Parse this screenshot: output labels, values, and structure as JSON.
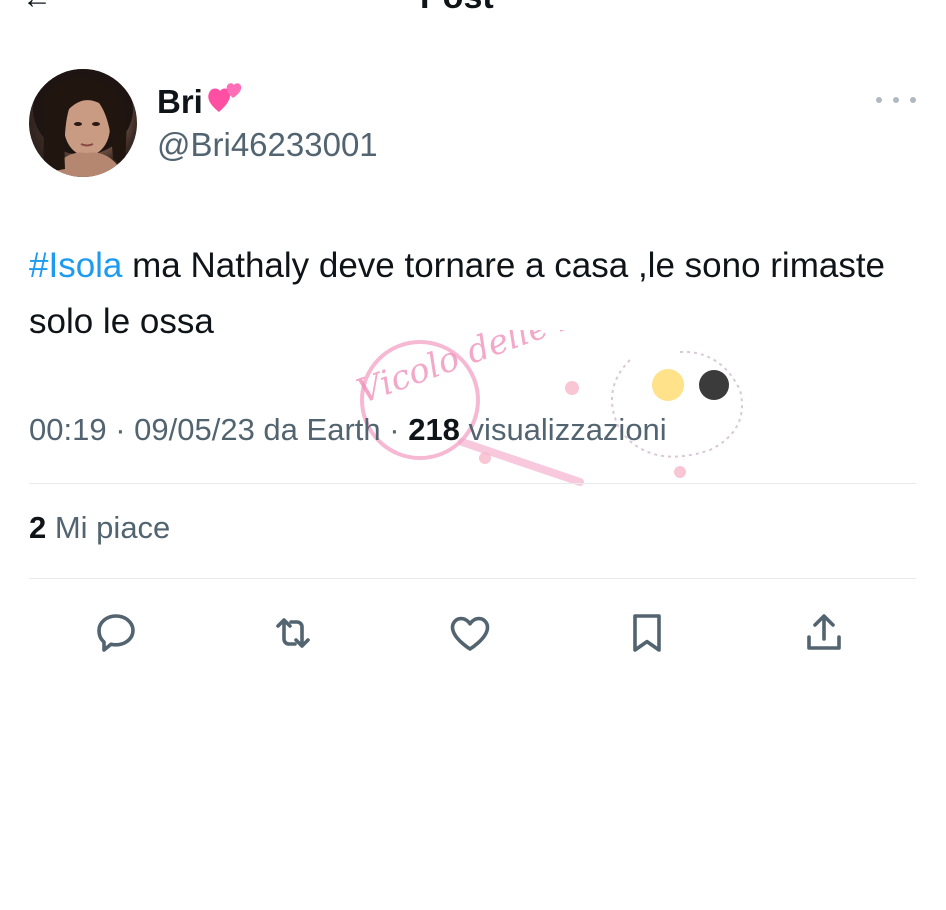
{
  "header": {
    "title": "Post",
    "back_icon": "arrow-left-icon"
  },
  "author": {
    "display_name": "Bri",
    "emoji": "💕",
    "handle": "@Bri46233001"
  },
  "tweet": {
    "hashtag": "#Isola",
    "text": " ma Nathaly deve tornare a casa ,le sono rimaste solo le ossa"
  },
  "meta": {
    "time": "00:19",
    "sep1": " · ",
    "date": "09/05/23",
    "source_prefix": " da ",
    "source": "Earth",
    "sep2": " · ",
    "views_count": "218",
    "views_label": " visualizzazioni"
  },
  "stats": {
    "likes_count": "2",
    "likes_label": " Mi piace"
  },
  "actions": [
    {
      "name": "reply",
      "icon": "reply-icon"
    },
    {
      "name": "retweet",
      "icon": "retweet-icon"
    },
    {
      "name": "like",
      "icon": "heart-icon"
    },
    {
      "name": "bookmark",
      "icon": "bookmark-icon"
    },
    {
      "name": "share",
      "icon": "share-icon"
    }
  ],
  "watermark": {
    "text": "Vicolo delle News"
  },
  "colors": {
    "text": "#0f1419",
    "secondary": "#536471",
    "accent": "#1d9bf0",
    "divider": "#e7e9ea"
  }
}
